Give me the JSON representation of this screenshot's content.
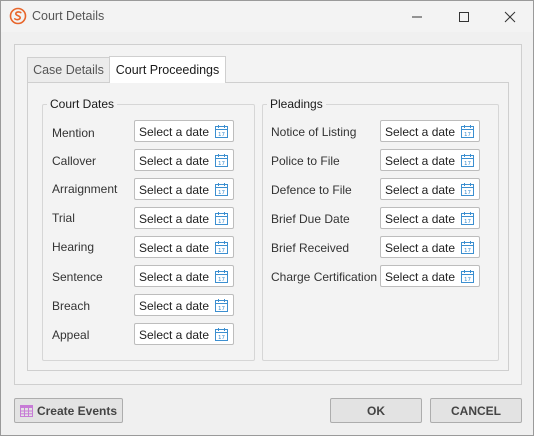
{
  "window": {
    "title": "Court Details",
    "controls": {
      "minimize": "minimize-icon",
      "maximize": "maximize-icon",
      "close": "close-icon"
    }
  },
  "tabs": [
    {
      "label": "Case Details",
      "active": false
    },
    {
      "label": "Court Proceedings",
      "active": true
    }
  ],
  "court_dates": {
    "title": "Court Dates",
    "fields": [
      {
        "label": "Mention",
        "placeholder": "Select a date"
      },
      {
        "label": "Callover",
        "placeholder": "Select a date"
      },
      {
        "label": "Arraignment",
        "placeholder": "Select a date"
      },
      {
        "label": "Trial",
        "placeholder": "Select a date"
      },
      {
        "label": "Hearing",
        "placeholder": "Select a date"
      },
      {
        "label": "Sentence",
        "placeholder": "Select a date"
      },
      {
        "label": "Breach",
        "placeholder": "Select a date"
      },
      {
        "label": "Appeal",
        "placeholder": "Select a date"
      }
    ]
  },
  "pleadings": {
    "title": "Pleadings",
    "fields": [
      {
        "label": "Notice of Listing",
        "placeholder": "Select a date"
      },
      {
        "label": "Police to File",
        "placeholder": "Select a date"
      },
      {
        "label": "Defence to File",
        "placeholder": "Select a date"
      },
      {
        "label": "Brief Due Date",
        "placeholder": "Select a date"
      },
      {
        "label": "Brief Received",
        "placeholder": "Select a date"
      },
      {
        "label": "Charge Certification",
        "placeholder": "Select a date"
      }
    ]
  },
  "buttons": {
    "create_events": "Create Events",
    "ok": "OK",
    "cancel": "CANCEL"
  },
  "colors": {
    "app_icon": "#e8652a",
    "calendar_icon": "#3c8fd0",
    "create_events_icon": "#c77bd6"
  }
}
